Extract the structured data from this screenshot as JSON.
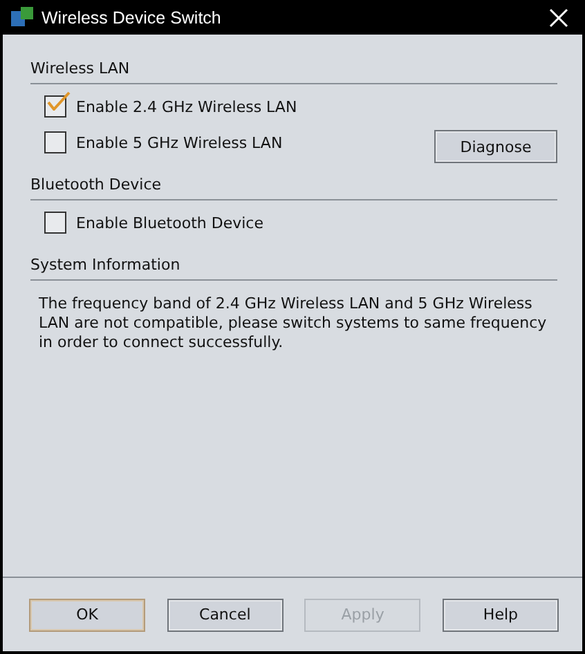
{
  "window": {
    "title": "Wireless Device Switch"
  },
  "sections": [
    {
      "title": "Wireless LAN",
      "options": [
        {
          "label": "Enable 2.4 GHz Wireless LAN",
          "checked": true
        },
        {
          "label": "Enable 5 GHz Wireless LAN",
          "checked": false
        }
      ],
      "button": "Diagnose"
    },
    {
      "title": "Bluetooth Device",
      "options": [
        {
          "label": "Enable Bluetooth Device",
          "checked": false
        }
      ]
    },
    {
      "title": "System Information",
      "text": "The frequency band of 2.4 GHz Wireless LAN and 5 GHz Wireless LAN are not compatible, please switch systems to same frequency in order to connect successfully."
    }
  ],
  "buttons": [
    {
      "label": "OK",
      "default": true,
      "disabled": false
    },
    {
      "label": "Cancel",
      "default": false,
      "disabled": false
    },
    {
      "label": "Apply",
      "default": false,
      "disabled": true
    },
    {
      "label": "Help",
      "default": false,
      "disabled": false
    }
  ]
}
